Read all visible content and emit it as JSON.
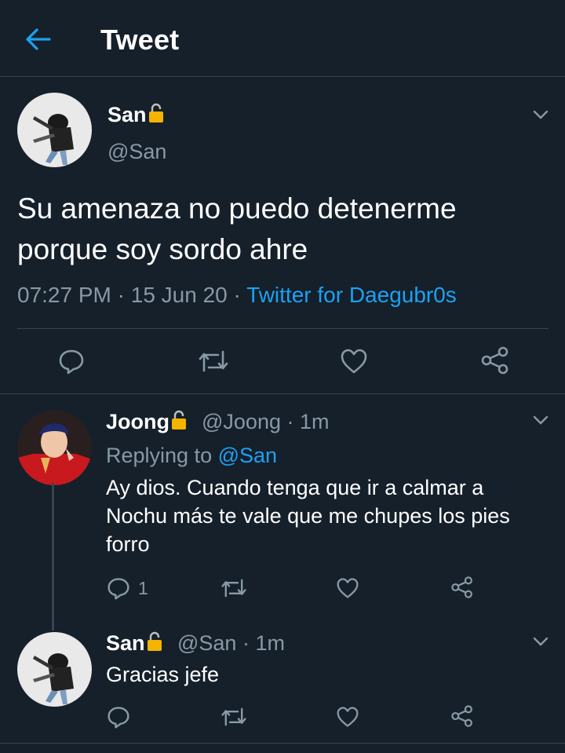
{
  "header": {
    "title": "Tweet",
    "back_icon": "arrow-left-icon",
    "accent": "#1da1f2"
  },
  "main_tweet": {
    "author_name": "San",
    "author_handle": "@San",
    "text": "Su amenaza no puedo detenerme porque soy sordo ahre",
    "time": "07:27 PM",
    "dot1": "·",
    "date": "15 Jun 20",
    "dot2": "·",
    "source": "Twitter for Daegubr0s",
    "lock_icon": "lock-icon"
  },
  "replies": [
    {
      "author_name": "Joong",
      "author_handle": "@Joong · 1m",
      "replying_prefix": "Replying to ",
      "replying_to": "@San",
      "text": "Ay dios. Cuando tenga que ir a calmar a Nochu más te vale que me chupes los pies forro",
      "reply_count": "1"
    },
    {
      "author_name": "San",
      "author_handle": "@San · 1m",
      "text": "Gracias jefe"
    }
  ],
  "colors": {
    "background": "#15202b",
    "border": "#38444d",
    "muted": "#8899a6",
    "link": "#1da1f2",
    "lock": "#f4b400"
  }
}
